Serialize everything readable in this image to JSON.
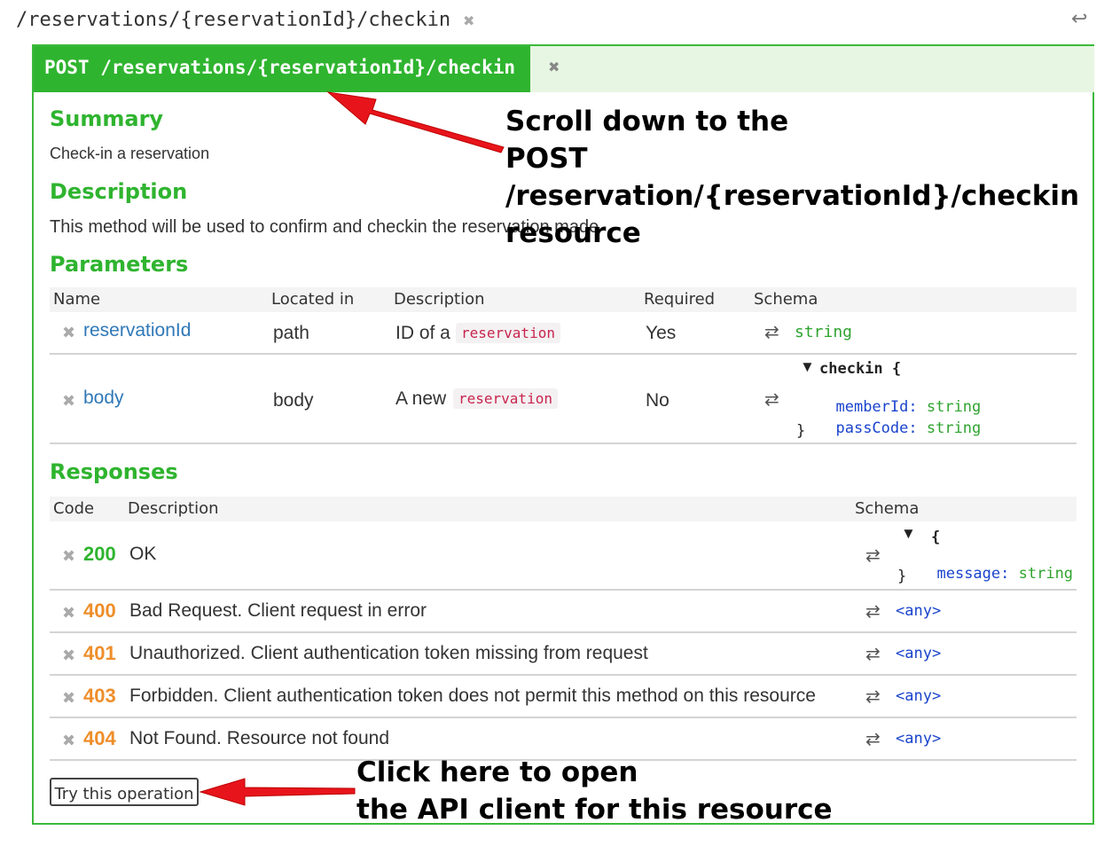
{
  "path_title": "/reservations/{reservationId}/checkin",
  "operation": {
    "label": "POST /reservations/{reservationId}/checkin"
  },
  "summary": {
    "title": "Summary",
    "text": "Check-in a reservation"
  },
  "description": {
    "title": "Description",
    "text": "This method will be used to confirm and checkin the reservation made"
  },
  "parameters": {
    "title": "Parameters",
    "headers": {
      "name": "Name",
      "located_in": "Located in",
      "description": "Description",
      "required": "Required",
      "schema": "Schema"
    },
    "rows": [
      {
        "name": "reservationId",
        "located_in": "path",
        "desc_prefix": "ID of a",
        "desc_tag": "reservation",
        "required": "Yes",
        "schema_type": "string"
      },
      {
        "name": "body",
        "located_in": "body",
        "desc_prefix": "A new",
        "desc_tag": "reservation",
        "required": "No",
        "schema_name": "checkin {",
        "schema_props": [
          {
            "name": "memberId:",
            "type": "string"
          },
          {
            "name": "passCode:",
            "type": "string"
          }
        ],
        "schema_close": "}"
      }
    ]
  },
  "responses": {
    "title": "Responses",
    "headers": {
      "code": "Code",
      "description": "Description",
      "schema": "Schema"
    },
    "rows": [
      {
        "code": "200",
        "description": "OK",
        "schema_open": "{",
        "schema_prop": "message:",
        "schema_type": "string",
        "schema_close": "}"
      },
      {
        "code": "400",
        "description": "Bad Request. Client request in error",
        "schema": "<any>"
      },
      {
        "code": "401",
        "description": "Unauthorized. Client authentication token missing from request",
        "schema": "<any>"
      },
      {
        "code": "403",
        "description": "Forbidden. Client authentication token does not permit this method on this resource",
        "schema": "<any>"
      },
      {
        "code": "404",
        "description": "Not Found. Resource not found",
        "schema": "<any>"
      }
    ]
  },
  "try_button": "Try this operation",
  "annotations": {
    "scroll": [
      "Scroll down to the",
      "POST /reservation/{reservationId}/checkin",
      "resource"
    ],
    "click": [
      "Click here to open",
      "the API client for this resource"
    ]
  },
  "icons": {
    "close": "close-icon",
    "back": "back-arrow-icon",
    "swap": "swap-icon",
    "expand": "triangle-down-icon"
  },
  "colors": {
    "accent_green": "#2fb42f",
    "header_band": "#e7f6e2",
    "code_4xx": "#ee8e2a",
    "link": "#2f78b7",
    "annotation_arrow": "#e8141b"
  }
}
